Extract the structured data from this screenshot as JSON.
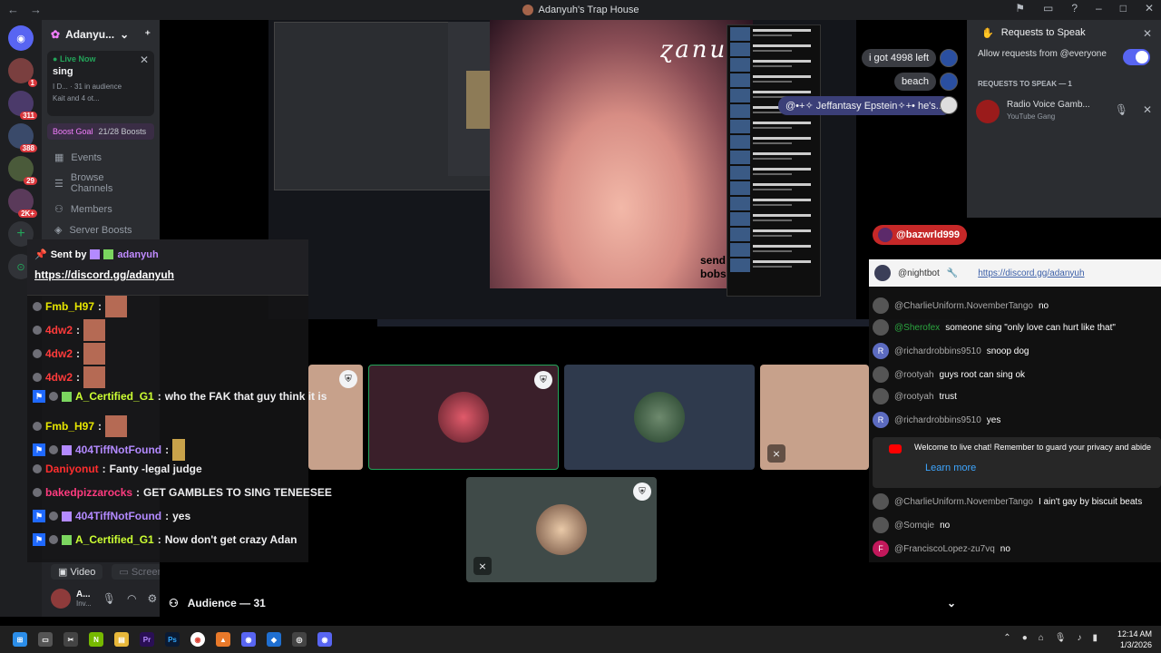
{
  "window": {
    "title": "Adanyuh's Trap House"
  },
  "server": {
    "name": "Adanyu...",
    "live": {
      "status": "Live Now",
      "title": "sing",
      "meta_line1": "I D... · 31 in audience",
      "meta_line2": "Kait and 4 ot..."
    },
    "boost": {
      "label": "Boost Goal",
      "count": "21/28 Boosts"
    },
    "channels": [
      "Events",
      "Browse Channels",
      "Members",
      "Server Boosts"
    ]
  },
  "guild_badges": [
    "1",
    "311",
    "388",
    "29",
    "2K+"
  ],
  "user_panel": {
    "video_label": "Video",
    "screen_label": "Screen",
    "name": "A...",
    "status": "Inv..."
  },
  "stage": {
    "screen_share": {
      "caption": "send bobs",
      "handwriting": "ɀanun"
    },
    "chat_bubbles": [
      "i got 4998 left",
      "beach",
      "@•+✧ Jeffantasy Epstein✧+• he's..."
    ],
    "audience_label": "Audience — 31"
  },
  "twitch_chat": {
    "sent_by_label": "Sent by",
    "sent_by_name": "adanyuh",
    "sent_link": "https://discord.gg/adanyuh",
    "lines": [
      {
        "user": "Fmb_H97",
        "sep": ":",
        "msg": "",
        "color": "#e6e600"
      },
      {
        "user": "4dw2",
        "sep": ":",
        "msg": "",
        "color": "#ff3b3b"
      },
      {
        "user": "4dw2",
        "sep": ":",
        "msg": "",
        "color": "#ff3b3b"
      },
      {
        "user": "4dw2",
        "sep": ":",
        "msg": "",
        "color": "#ff3b3b"
      },
      {
        "user": "A_Certified_G1",
        "sep": ":",
        "msg": "who the FAK that guy think it is",
        "color": "#ccff33"
      },
      {
        "user": "Fmb_H97",
        "sep": ":",
        "msg": "",
        "color": "#e6e600"
      },
      {
        "user": "404TiffNotFound",
        "sep": ":",
        "msg": "",
        "color": "#b38aff"
      },
      {
        "user": "Daniyonut",
        "sep": ":",
        "msg": "Fanty -legal judge",
        "color": "#ff2e2e"
      },
      {
        "user": "bakedpizzarocks",
        "sep": ":",
        "msg": "GET GAMBLES TO SING TENEESEE",
        "color": "#ff3b7f"
      },
      {
        "user": "404TiffNotFound",
        "sep": ":",
        "msg": "yes",
        "color": "#b38aff"
      },
      {
        "user": "A_Certified_G1",
        "sep": ":",
        "msg": "Now don't get crazy Adan",
        "color": "#ccff33"
      }
    ]
  },
  "youtube_chat": {
    "top_user": "@bazwrld999",
    "nightbot_user": "@nightbot",
    "nightbot_link": "https://discord.gg/adanyuh",
    "rows": [
      {
        "avatar": "",
        "user": "@CharlieUniform.NovemberTango",
        "msg": "no",
        "green": false
      },
      {
        "avatar": "",
        "user": "@Sherofex",
        "msg": "someone sing \"only love can hurt like that\"",
        "green": true
      },
      {
        "avatar": "R",
        "user": "@richardrobbins9510",
        "msg": "snoop dog",
        "green": false
      },
      {
        "avatar": "",
        "user": "@rootyah",
        "msg": "guys root can sing ok",
        "green": false
      },
      {
        "avatar": "",
        "user": "@rootyah",
        "msg": "trust",
        "green": false
      },
      {
        "avatar": "R",
        "user": "@richardrobbins9510",
        "msg": "yes",
        "green": false
      }
    ],
    "welcome_text": "Welcome to live chat! Remember to guard your privacy and abide",
    "learn_more": "Learn more",
    "rows_after": [
      {
        "avatar": "",
        "user": "@CharlieUniform.NovemberTango",
        "msg": "I ain't gay by biscuit beats",
        "green": false
      },
      {
        "avatar": "",
        "user": "@Somqie",
        "msg": "no",
        "green": false
      },
      {
        "avatar": "F",
        "user": "@FranciscoLopez-zu7vq",
        "msg": "no",
        "green": false
      }
    ]
  },
  "requests_to_speak": {
    "title": "Requests to Speak",
    "allow_label": "Allow requests from @everyone",
    "section_label": "REQUESTS TO SPEAK — 1",
    "requester_name": "Radio Voice Gamb...",
    "requester_sub": "YouTube Gang"
  },
  "taskbar": {
    "time": "12:14 AM",
    "date": "1/3/2026"
  },
  "colors": {
    "accent": "#5865f2",
    "live_green": "#23a55a",
    "yt_red": "#c62828"
  }
}
